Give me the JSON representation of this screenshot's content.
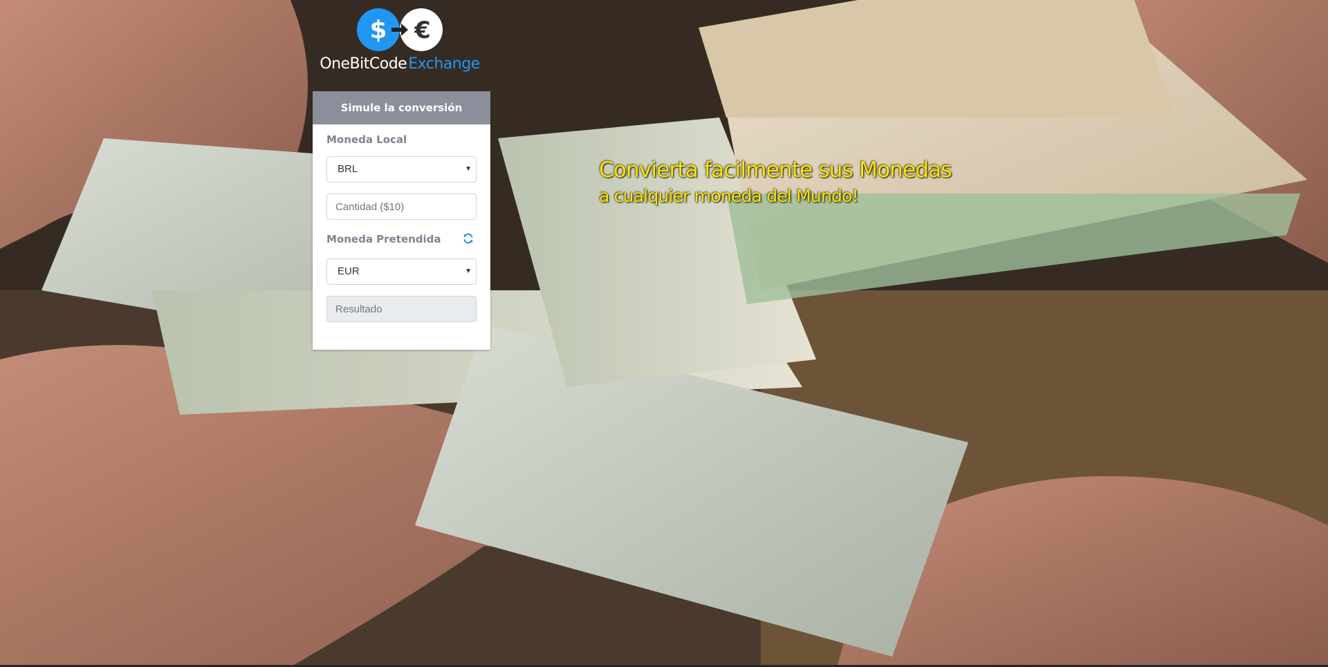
{
  "brand": {
    "name_part1": "OneBitCode",
    "name_part2": "Exchange",
    "logo_icon": "dollar-euro-exchange-logo",
    "colors": {
      "blue": "#2196f3",
      "white": "#ffffff"
    }
  },
  "converter": {
    "title": "Simule la conversión",
    "local_currency_label": "Moneda Local",
    "local_currency_value": "BRL",
    "amount_placeholder": "Cantidad ($10)",
    "amount_value": "",
    "target_currency_label": "Moneda Pretendida",
    "swap_icon": "refresh-icon",
    "target_currency_value": "EUR",
    "result_placeholder": "Resultado",
    "result_value": ""
  },
  "hero": {
    "line1": "Convierta facilmente sus Monedas",
    "line2": "a cualquier moneda del Mundo!",
    "color": "#ffe600"
  },
  "background": {
    "icon": "banknotes-exchange-photo"
  }
}
